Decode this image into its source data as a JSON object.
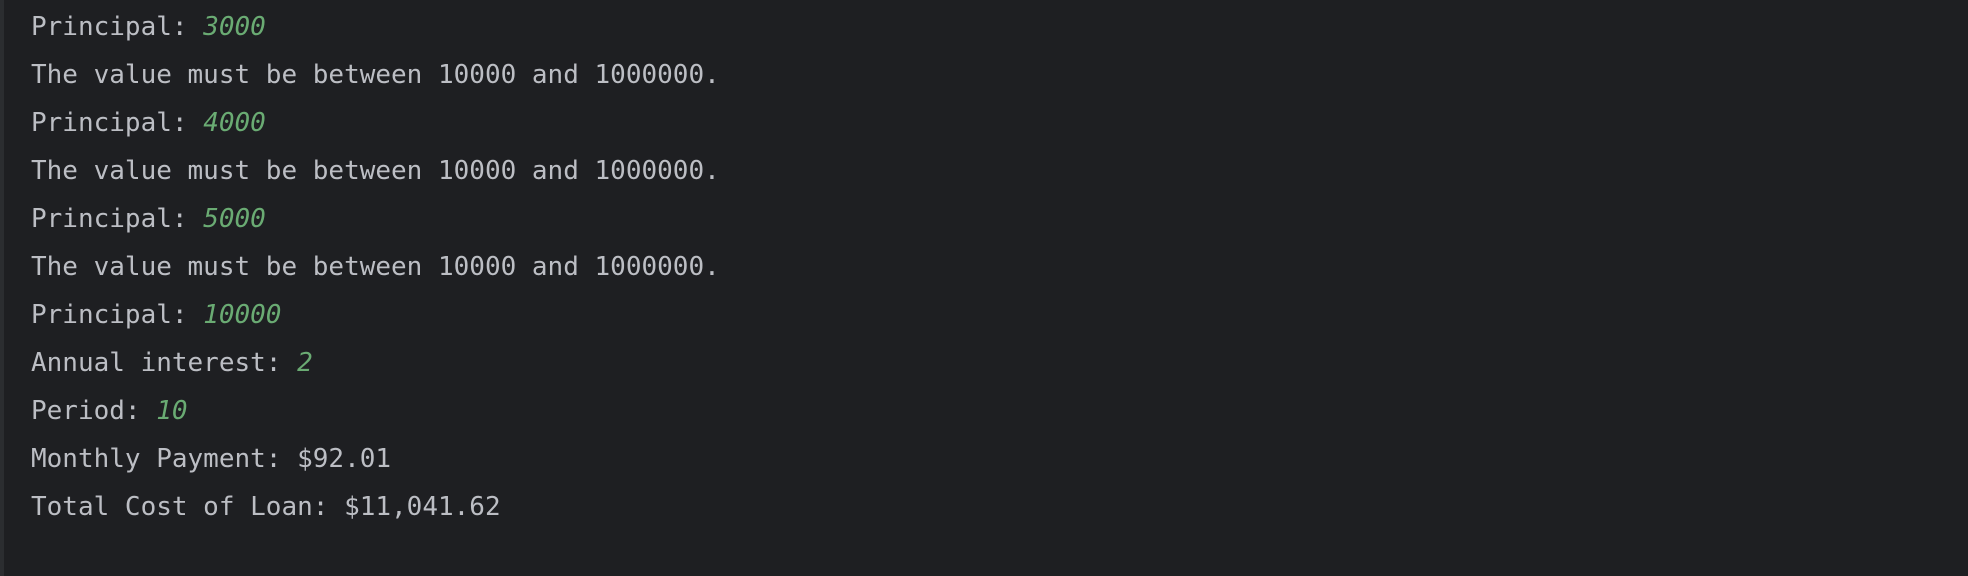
{
  "console": {
    "lines": [
      {
        "text": "Principal: ",
        "input": "3000"
      },
      {
        "text": "The value must be between 10000 and 1000000.",
        "input": ""
      },
      {
        "text": "Principal: ",
        "input": "4000"
      },
      {
        "text": "The value must be between 10000 and 1000000.",
        "input": ""
      },
      {
        "text": "Principal: ",
        "input": "5000"
      },
      {
        "text": "The value must be between 10000 and 1000000.",
        "input": ""
      },
      {
        "text": "Principal: ",
        "input": "10000"
      },
      {
        "text": "Annual interest: ",
        "input": "2"
      },
      {
        "text": "Period: ",
        "input": "10"
      },
      {
        "text": "Monthly Payment: $92.01",
        "input": ""
      },
      {
        "text": "Total Cost of Loan: $11,041.62",
        "input": ""
      }
    ]
  },
  "colors": {
    "background": "#1e1f22",
    "text": "#bcbec4",
    "user_input": "#6aab73"
  }
}
